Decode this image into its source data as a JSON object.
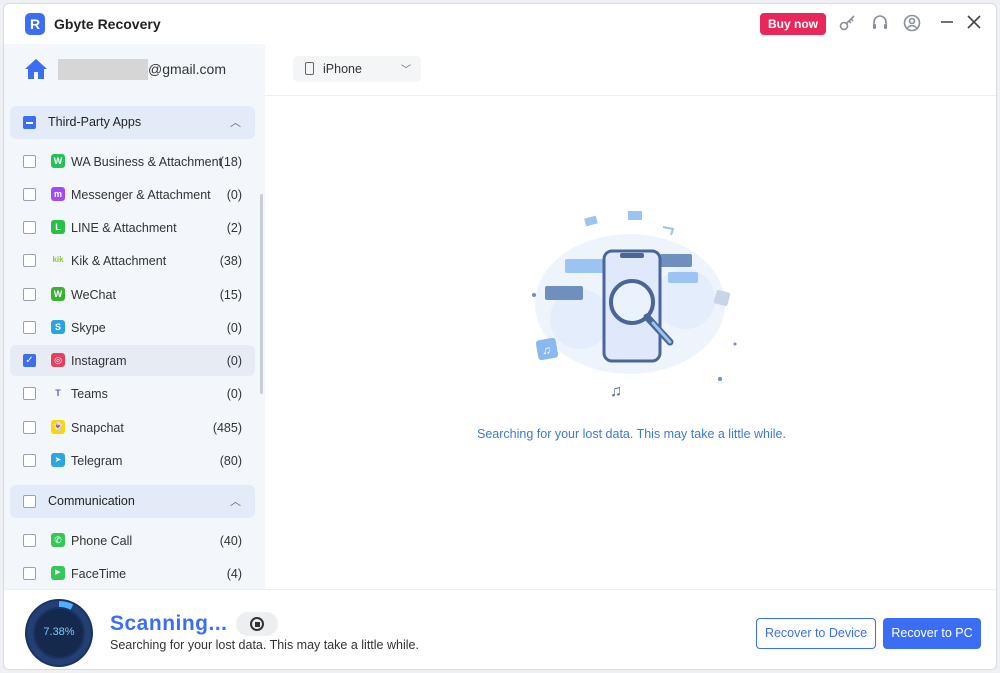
{
  "app": {
    "title": "Gbyte Recovery",
    "logo_letter": "R"
  },
  "titlebar": {
    "buy_label": "Buy now"
  },
  "account": {
    "email_suffix": "@gmail.com"
  },
  "sections": [
    {
      "label": "Third-Party Apps",
      "state": "partial",
      "items": [
        {
          "name": "WA Business & Attachment",
          "count": "(18)",
          "icon": "whatsapp-icon",
          "color": "#25c05a",
          "glyph": "W"
        },
        {
          "name": "Messenger & Attachment",
          "count": "(0)",
          "icon": "messenger-icon",
          "color": "#a04cf0",
          "glyph": "m"
        },
        {
          "name": "LINE & Attachment",
          "count": "(2)",
          "icon": "line-icon",
          "color": "#27c144",
          "glyph": "L"
        },
        {
          "name": "Kik & Attachment",
          "count": "(38)",
          "icon": "kik-icon",
          "color": "#8dc63f",
          "glyph": "kik"
        },
        {
          "name": "WeChat",
          "count": "(15)",
          "icon": "wechat-icon",
          "color": "#3cb034",
          "glyph": "W"
        },
        {
          "name": "Skype",
          "count": "(0)",
          "icon": "skype-icon",
          "color": "#2aa5e0",
          "glyph": "S"
        },
        {
          "name": "Instagram",
          "count": "(0)",
          "icon": "instagram-icon",
          "color": "#e4405f",
          "glyph": "◎",
          "checked": true
        },
        {
          "name": "Teams",
          "count": "(0)",
          "icon": "teams-icon",
          "color": "#6264a7",
          "glyph": "T"
        },
        {
          "name": "Snapchat",
          "count": "(485)",
          "icon": "snapchat-icon",
          "color": "#f7d800",
          "glyph": "👻"
        },
        {
          "name": "Telegram",
          "count": "(80)",
          "icon": "telegram-icon",
          "color": "#2ca5e0",
          "glyph": "➤"
        }
      ]
    },
    {
      "label": "Communication",
      "state": "unchecked",
      "items": [
        {
          "name": "Phone Call",
          "count": "(40)",
          "icon": "phone-icon",
          "color": "#34c759",
          "glyph": "✆"
        },
        {
          "name": "FaceTime",
          "count": "(4)",
          "icon": "facetime-icon",
          "color": "#34c759",
          "glyph": "▶"
        }
      ]
    }
  ],
  "device": {
    "name": "iPhone"
  },
  "main": {
    "status": "Searching for your lost data. This may take a little while."
  },
  "scan": {
    "progress": "7.38%",
    "progress_value": 0.0738,
    "title": "Scanning...",
    "subtitle": "Searching for your lost data. This may take a little while."
  },
  "actions": {
    "recover_device": "Recover to Device",
    "recover_pc": "Recover to PC"
  },
  "colors": {
    "accent": "#3b6ef2",
    "buy": "#e8285a",
    "status_text": "#3a7bd5"
  }
}
